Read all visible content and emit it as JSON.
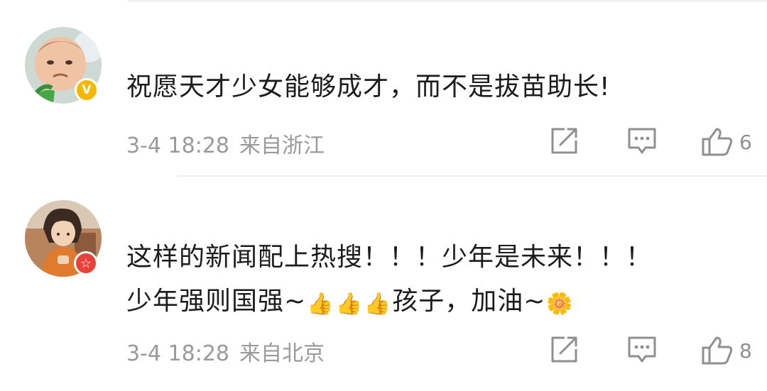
{
  "comments": [
    {
      "text": "祝愿天才少女能够成才，而不是拔苗助长!",
      "time": "3-4 18:28",
      "location": "来自浙江",
      "likes": "6",
      "avatar_icon": "toddler-avatar",
      "badge_icon": "verified-v-badge",
      "badge_label": "V",
      "badge_color": "#f5b800"
    },
    {
      "line1": "这样的新闻配上热搜！！！少年是未来！！！",
      "line2_prefix": "少年强则国强~",
      "line2_mid": "孩子，加油~",
      "emojis": [
        "👍",
        "👍",
        "👍",
        "🌼"
      ],
      "time": "3-4 18:28",
      "location": "来自北京",
      "likes": "8",
      "avatar_icon": "illustrated-girl-avatar",
      "badge_icon": "red-star-badge",
      "badge_label": "☆",
      "badge_color": "#e8413a"
    }
  ],
  "actions": {
    "share_icon": "share-icon",
    "reply_icon": "reply-icon",
    "like_icon": "thumbs-up-icon"
  }
}
